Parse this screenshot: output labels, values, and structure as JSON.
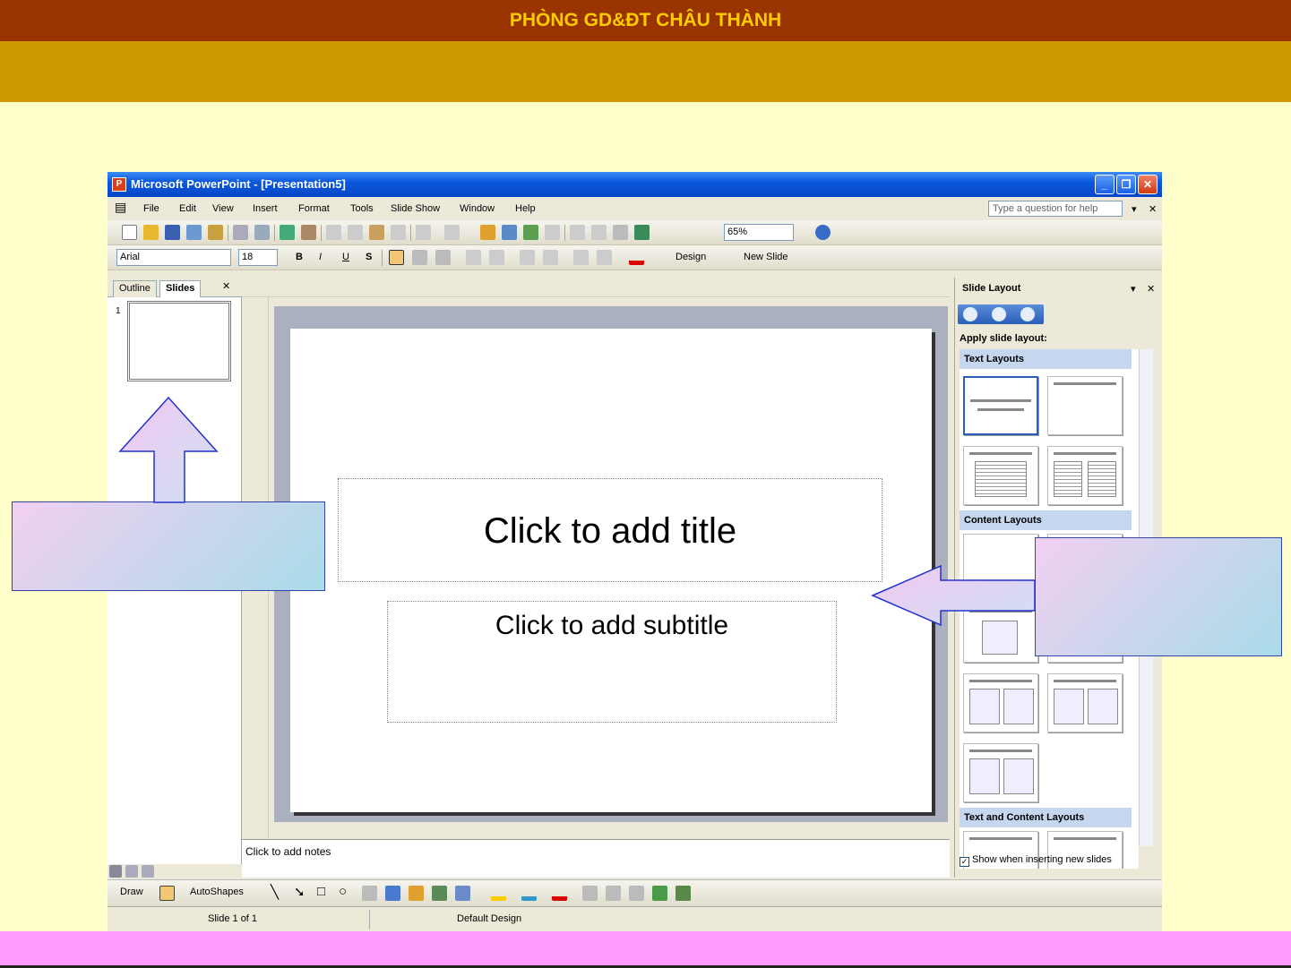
{
  "header": {
    "title": "PHÒNG GD&ĐT CHÂU THÀNH"
  },
  "window": {
    "title": "Microsoft PowerPoint - [Presentation5]",
    "menu": [
      "File",
      "Edit",
      "View",
      "Insert",
      "Format",
      "Tools",
      "Slide Show",
      "Window",
      "Help"
    ],
    "help_placeholder": "Type a question for help",
    "zoom": "65%",
    "font": "Arial",
    "font_size": "18",
    "format_buttons": {
      "bold": "B",
      "italic": "I",
      "underline": "U",
      "shadow": "S"
    },
    "design_label": "Design",
    "new_slide_label": "New Slide"
  },
  "left_pane": {
    "tabs": [
      "Outline",
      "Slides"
    ],
    "slide_number": "1"
  },
  "slide": {
    "title_placeholder": "Click to add title",
    "subtitle_placeholder": "Click to add subtitle"
  },
  "notes": {
    "placeholder": "Click to add notes"
  },
  "task_pane": {
    "title": "Slide Layout",
    "apply_label": "Apply slide layout:",
    "categories": [
      "Text Layouts",
      "Content Layouts",
      "Text and Content Layouts"
    ],
    "show_checkbox": "Show when inserting new slides"
  },
  "drawing": {
    "draw_label": "Draw",
    "autoshapes_label": "AutoShapes"
  },
  "status": {
    "slide": "Slide 1 of 1",
    "design": "Default Design"
  }
}
